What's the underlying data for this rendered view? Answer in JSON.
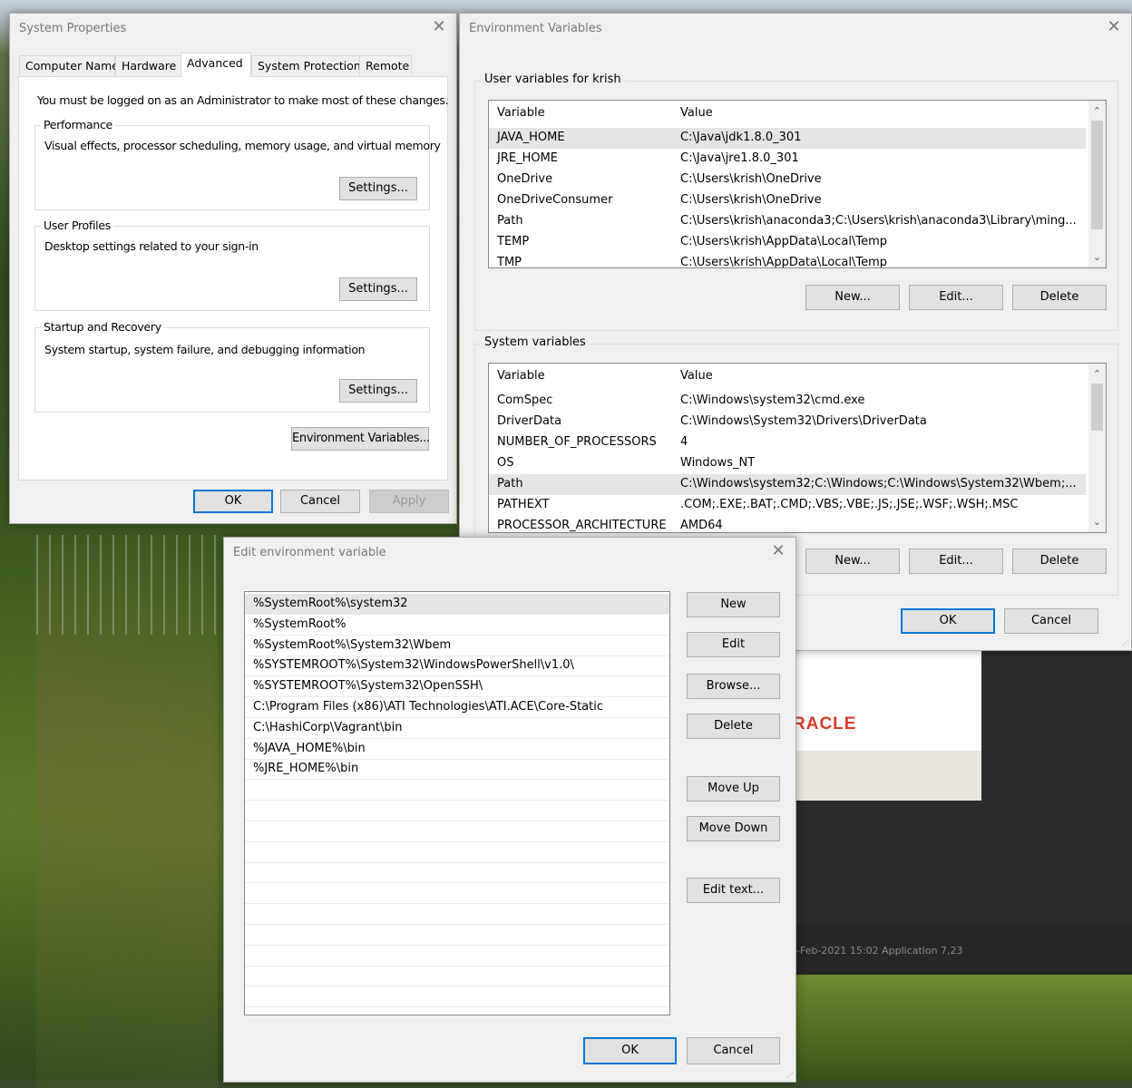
{
  "background_app": {
    "logo_text": "RACLE",
    "bottom_bar_text": "-Feb-2021 15:02          Application          7,23"
  },
  "system_properties": {
    "title": "System Properties",
    "tabs": [
      "Computer Name",
      "Hardware",
      "Advanced",
      "System Protection",
      "Remote"
    ],
    "active_tab": "Advanced",
    "admin_note": "You must be logged on as an Administrator to make most of these changes.",
    "performance": {
      "label": "Performance",
      "description": "Visual effects, processor scheduling, memory usage, and virtual memory",
      "button": "Settings..."
    },
    "user_profiles": {
      "label": "User Profiles",
      "description": "Desktop settings related to your sign-in",
      "button": "Settings..."
    },
    "startup_recovery": {
      "label": "Startup and Recovery",
      "description": "System startup, system failure, and debugging information",
      "button": "Settings..."
    },
    "env_button": "Environment Variables...",
    "ok": "OK",
    "cancel": "Cancel",
    "apply": "Apply"
  },
  "environment_variables": {
    "title": "Environment Variables",
    "user_section_label": "User variables for krish",
    "system_section_label": "System variables",
    "col_variable": "Variable",
    "col_value": "Value",
    "user_vars": [
      {
        "name": "JAVA_HOME",
        "value": "C:\\Java\\jdk1.8.0_301"
      },
      {
        "name": "JRE_HOME",
        "value": "C:\\Java\\jre1.8.0_301"
      },
      {
        "name": "OneDrive",
        "value": "C:\\Users\\krish\\OneDrive"
      },
      {
        "name": "OneDriveConsumer",
        "value": "C:\\Users\\krish\\OneDrive"
      },
      {
        "name": "Path",
        "value": "C:\\Users\\krish\\anaconda3;C:\\Users\\krish\\anaconda3\\Library\\ming..."
      },
      {
        "name": "TEMP",
        "value": "C:\\Users\\krish\\AppData\\Local\\Temp"
      },
      {
        "name": "TMP",
        "value": "C:\\Users\\krish\\AppData\\Local\\Temp"
      }
    ],
    "system_vars": [
      {
        "name": "ComSpec",
        "value": "C:\\Windows\\system32\\cmd.exe"
      },
      {
        "name": "DriverData",
        "value": "C:\\Windows\\System32\\Drivers\\DriverData"
      },
      {
        "name": "NUMBER_OF_PROCESSORS",
        "value": "4"
      },
      {
        "name": "OS",
        "value": "Windows_NT"
      },
      {
        "name": "Path",
        "value": "C:\\Windows\\system32;C:\\Windows;C:\\Windows\\System32\\Wbem;..."
      },
      {
        "name": "PATHEXT",
        "value": ".COM;.EXE;.BAT;.CMD;.VBS;.VBE;.JS;.JSE;.WSF;.WSH;.MSC"
      },
      {
        "name": "PROCESSOR_ARCHITECTURE",
        "value": "AMD64"
      }
    ],
    "user_buttons": {
      "new": "New...",
      "edit": "Edit...",
      "delete": "Delete"
    },
    "system_buttons": {
      "new": "New...",
      "edit": "Edit...",
      "delete": "Delete"
    },
    "ok": "OK",
    "cancel": "Cancel"
  },
  "edit_env_var": {
    "title": "Edit environment variable",
    "entries": [
      "%SystemRoot%\\system32",
      "%SystemRoot%",
      "%SystemRoot%\\System32\\Wbem",
      "%SYSTEMROOT%\\System32\\WindowsPowerShell\\v1.0\\",
      "%SYSTEMROOT%\\System32\\OpenSSH\\",
      "C:\\Program Files (x86)\\ATI Technologies\\ATI.ACE\\Core-Static",
      "C:\\HashiCorp\\Vagrant\\bin",
      "%JAVA_HOME%\\bin",
      "%JRE_HOME%\\bin",
      "",
      "",
      "",
      "",
      "",
      "",
      "",
      "",
      "",
      "",
      "",
      ""
    ],
    "buttons": {
      "new": "New",
      "edit": "Edit",
      "browse": "Browse...",
      "delete": "Delete",
      "move_up": "Move Up",
      "move_down": "Move Down",
      "edit_text": "Edit text..."
    },
    "ok": "OK",
    "cancel": "Cancel"
  },
  "icons": {
    "close": "✕",
    "scroll_up": "⌃",
    "scroll_down": "⌄"
  }
}
